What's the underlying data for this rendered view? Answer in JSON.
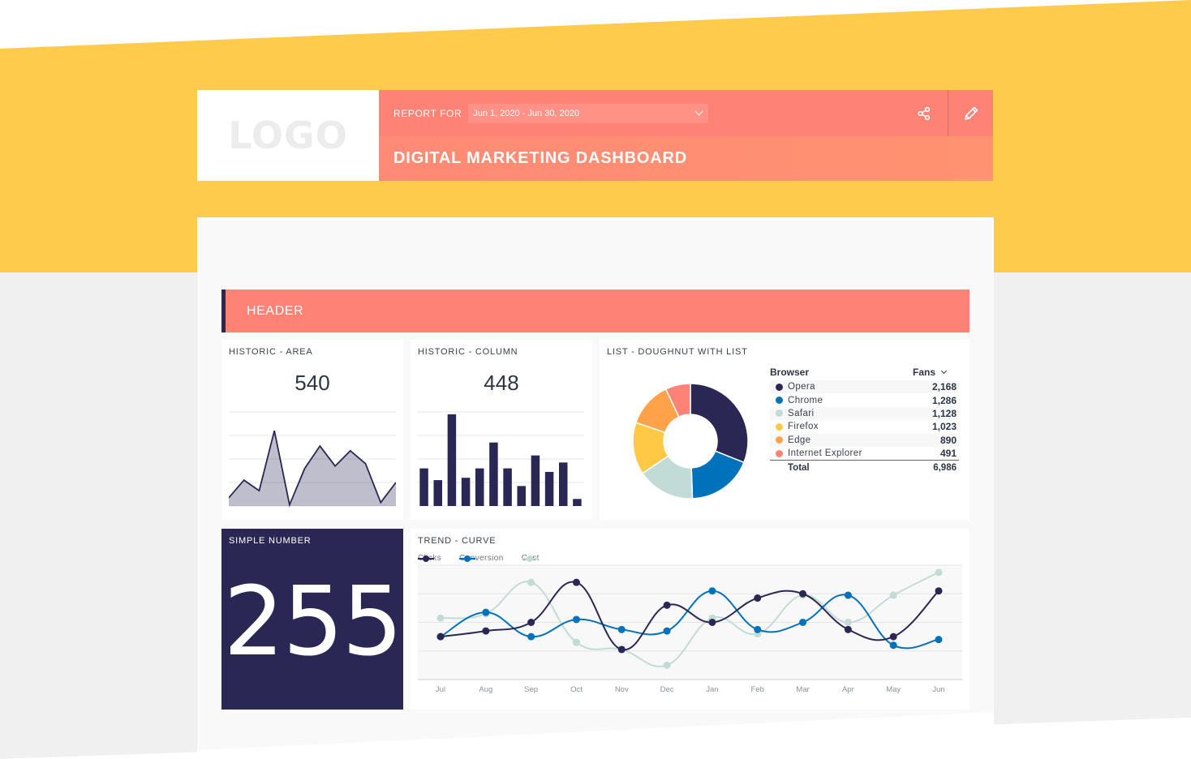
{
  "header": {
    "logo_text": "LOGO",
    "report_for_label": "REPORT FOR",
    "date_range": "Jun 1, 2020 - Jun 30, 2020",
    "title": "DIGITAL MARKETING DASHBOARD",
    "actions": [
      {
        "name": "share",
        "icon": "share-icon"
      },
      {
        "name": "edit",
        "icon": "pencil-icon"
      }
    ]
  },
  "section_header": "HEADER",
  "colors": {
    "accent_yellow": "#ffcb4c",
    "accent_coral": "#ff8277",
    "navy": "#2a2755",
    "blue": "#0072bb",
    "mint": "#c2dbd6",
    "yellow": "#ffc845",
    "orange": "#ffa24a",
    "pink": "#ff8277"
  },
  "cards": {
    "area": {
      "title": "HISTORIC - AREA",
      "value": "540"
    },
    "column": {
      "title": "HISTORIC - COLUMN",
      "value": "448"
    },
    "doughnut": {
      "title": "LIST - DOUGHNUT WITH LIST"
    },
    "simple_number": {
      "title": "SIMPLE NUMBER",
      "value": "255"
    },
    "trend": {
      "title": "TREND - CURVE"
    }
  },
  "fans_table": {
    "col_browser": "Browser",
    "col_fans": "Fans",
    "rows": [
      {
        "name": "Opera",
        "value": "2,168",
        "color": "#2a2755"
      },
      {
        "name": "Chrome",
        "value": "1,286",
        "color": "#0072bb"
      },
      {
        "name": "Safari",
        "value": "1,128",
        "color": "#c2dbd6"
      },
      {
        "name": "Firefox",
        "value": "1,023",
        "color": "#ffc845"
      },
      {
        "name": "Edge",
        "value": "890",
        "color": "#ffa24a"
      },
      {
        "name": "Internet Explorer",
        "value": "491",
        "color": "#ff8277"
      }
    ],
    "total_label": "Total",
    "total_value": "6,986"
  },
  "chart_data": [
    {
      "type": "area",
      "title": "HISTORIC - AREA",
      "values": [
        0.35,
        1.1,
        0.65,
        3.2,
        0.05,
        1.6,
        2.55,
        1.7,
        2.35,
        1.8,
        0.15,
        1.0
      ],
      "ylim": [
        0,
        4
      ],
      "grid": true
    },
    {
      "type": "bar",
      "title": "HISTORIC - COLUMN",
      "values": [
        1.6,
        1.1,
        3.9,
        1.2,
        1.6,
        2.7,
        1.6,
        0.85,
        2.15,
        1.45,
        1.85,
        0.3
      ],
      "ylim": [
        0,
        4
      ],
      "grid": true
    },
    {
      "type": "pie",
      "title": "LIST - DOUGHNUT WITH LIST",
      "categories": [
        "Opera",
        "Chrome",
        "Safari",
        "Firefox",
        "Edge",
        "Internet Explorer"
      ],
      "values": [
        2168,
        1286,
        1128,
        1023,
        890,
        491
      ],
      "colors": [
        "#2a2755",
        "#0072bb",
        "#c2dbd6",
        "#ffc845",
        "#ffa24a",
        "#ff8277"
      ],
      "donut": true
    },
    {
      "type": "line",
      "title": "TREND - CURVE",
      "x": [
        "Jul",
        "Aug",
        "Sep",
        "Oct",
        "Nov",
        "Dec",
        "Jan",
        "Feb",
        "Mar",
        "Apr",
        "May",
        "Jun"
      ],
      "series": [
        {
          "name": "Clicks",
          "color": "#2a2755",
          "values": [
            1.5,
            1.7,
            2.0,
            3.4,
            1.05,
            2.6,
            2.0,
            2.85,
            3.0,
            1.75,
            1.5,
            3.1
          ]
        },
        {
          "name": "Conversion",
          "color": "#0072bb",
          "values": [
            1.5,
            2.35,
            1.5,
            2.1,
            1.75,
            1.7,
            3.1,
            1.75,
            2.0,
            2.95,
            1.2,
            1.4
          ]
        },
        {
          "name": "Cost",
          "color": "#c2dbd6",
          "values": [
            2.15,
            2.3,
            3.4,
            1.3,
            1.05,
            0.5,
            2.15,
            1.6,
            2.95,
            2.0,
            2.95,
            3.75
          ]
        }
      ],
      "ylim": [
        0,
        4
      ],
      "grid": true,
      "legend": "top-left"
    }
  ]
}
